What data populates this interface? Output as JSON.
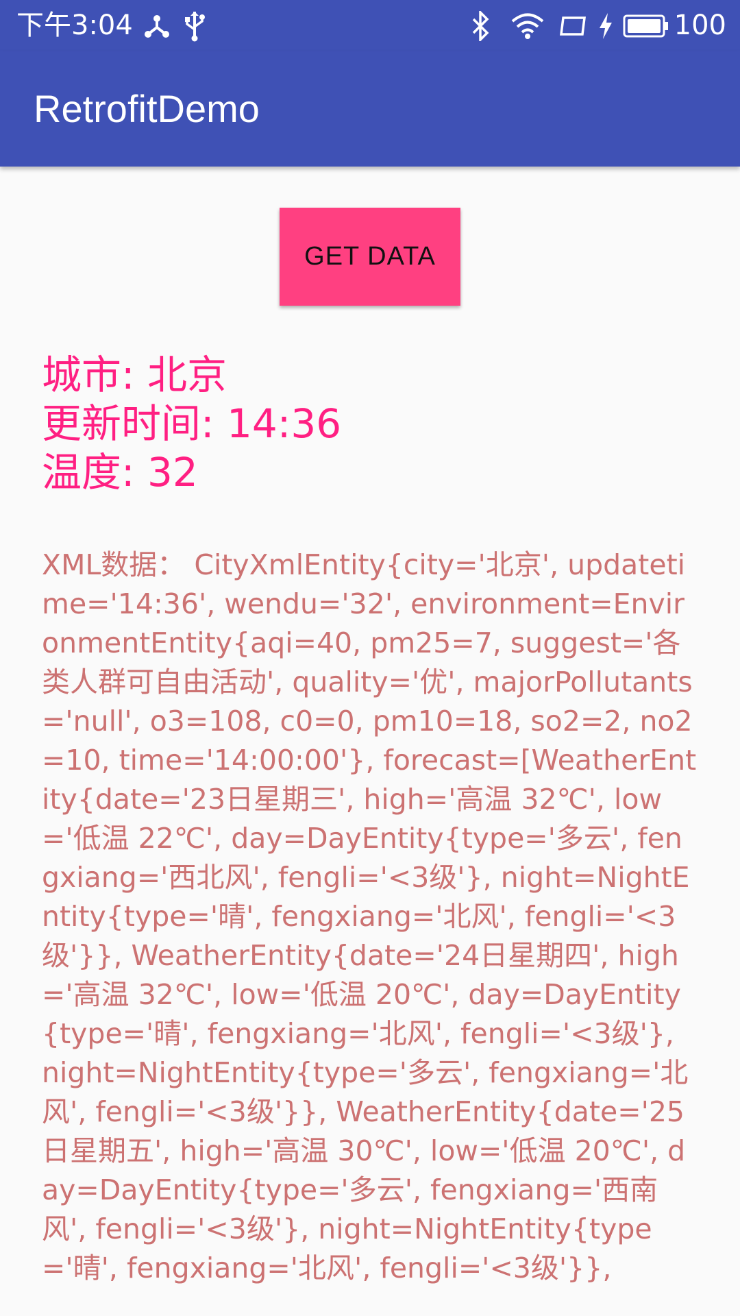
{
  "status_bar": {
    "time": "下午3:04",
    "battery_level": "100",
    "icons": [
      "share-hub-icon",
      "usb-icon",
      "bluetooth-icon",
      "wifi-icon",
      "screen-icon",
      "charging-icon",
      "battery-icon"
    ]
  },
  "app_bar": {
    "title": "RetrofitDemo",
    "color": "#3f51b5"
  },
  "button": {
    "label": "GET DATA",
    "color": "#ff4081"
  },
  "summary": {
    "city": "城市: 北京",
    "update_time": "更新时间: 14:36",
    "temperature": "温度: 32",
    "color": "#ff1f82"
  },
  "xml_data": {
    "text": "XML数据：  CityXmlEntity{city='北京', updatetime='14:36', wendu='32', environment=EnvironmentEntity{aqi=40, pm25=7, suggest='各类人群可自由活动', quality='优', majorPollutants='null', o3=108, c0=0, pm10=18, so2=2, no2=10, time='14:00:00'}, forecast=[WeatherEntity{date='23日星期三', high='高温 32℃', low='低温 22℃', day=DayEntity{type='多云', fengxiang='西北风', fengli='<3级'}, night=NightEntity{type='晴', fengxiang='北风', fengli='<3级'}}, WeatherEntity{date='24日星期四', high='高温 32℃', low='低温 20℃', day=DayEntity{type='晴', fengxiang='北风', fengli='<3级'}, night=NightEntity{type='多云', fengxiang='北风', fengli='<3级'}}, WeatherEntity{date='25日星期五', high='高温 30℃', low='低温 20℃', day=DayEntity{type='多云', fengxiang='西南风', fengli='<3级'}, night=NightEntity{type='晴', fengxiang='北风', fengli='<3级'}},",
    "color": "#cc7272"
  }
}
